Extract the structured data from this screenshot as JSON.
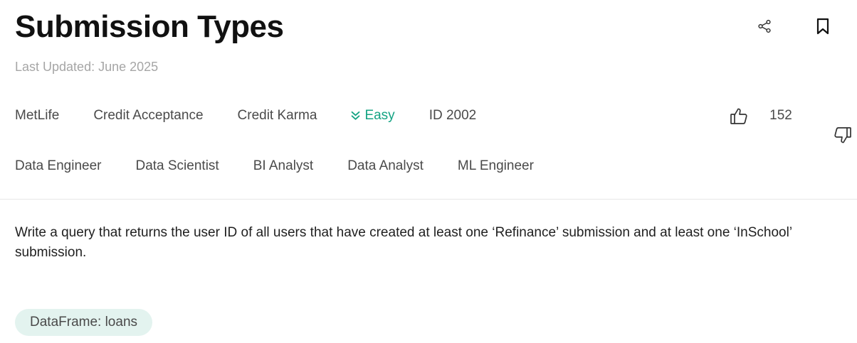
{
  "header": {
    "title": "Submission Types",
    "last_updated": "Last Updated: June 2025"
  },
  "icons": {
    "share": "share-icon",
    "bookmark": "bookmark-icon",
    "thumbs_up": "thumbs-up-icon",
    "thumbs_down": "thumbs-down-icon",
    "difficulty": "double-chevron-down-icon"
  },
  "companies": [
    "MetLife",
    "Credit Acceptance",
    "Credit Karma"
  ],
  "difficulty": {
    "label": "Easy",
    "color": "#14a383"
  },
  "question_id": "ID 2002",
  "votes": {
    "count": "152"
  },
  "roles": [
    "Data Engineer",
    "Data Scientist",
    "BI Analyst",
    "Data Analyst",
    "ML Engineer"
  ],
  "question": {
    "text": "Write a query that returns the user ID of all users that have created at least one ‘Refinance’ submission and at least one ‘InSchool’ submission."
  },
  "dataframe_chip": {
    "label": "DataFrame: loans"
  },
  "colors": {
    "accent": "#14a383",
    "chip_bg": "#e3f3ef",
    "muted_text": "#a6a6a6"
  }
}
